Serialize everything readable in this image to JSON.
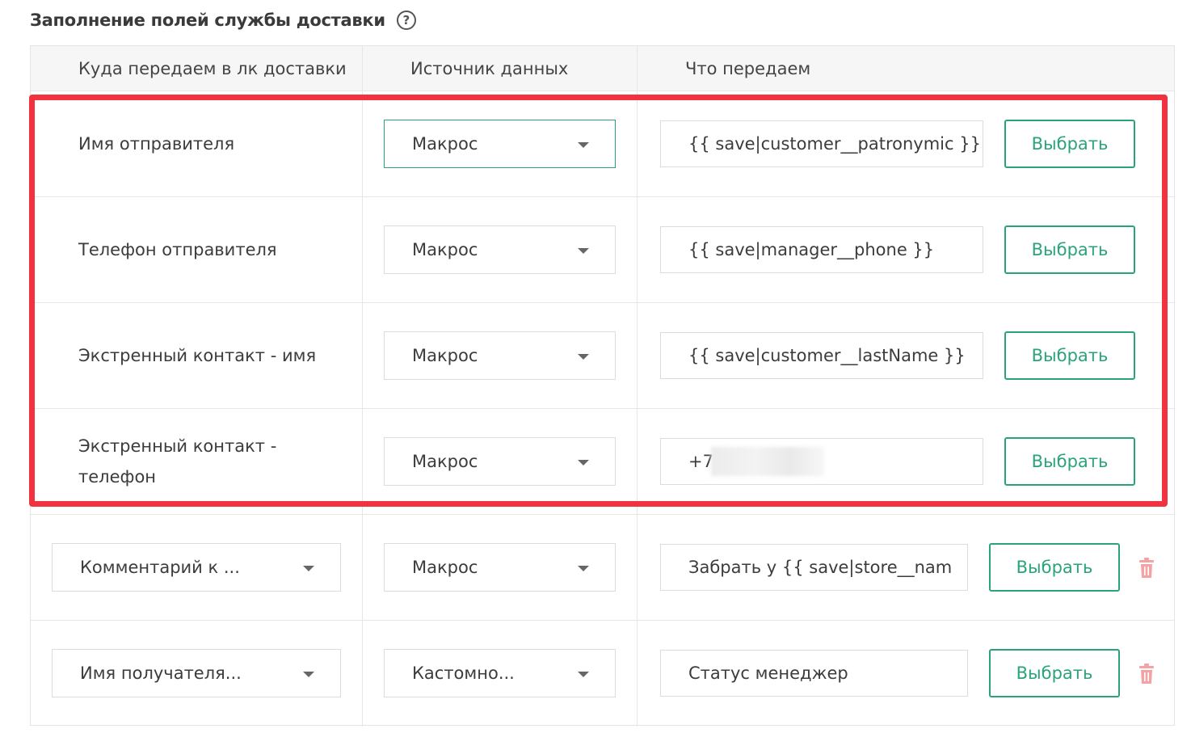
{
  "section": {
    "title": "Заполнение полей службы доставки",
    "help": "?"
  },
  "header": {
    "col1": "Куда передаем в лк доставки",
    "col2": "Источник данных",
    "col3": "Что передаем"
  },
  "rows": [
    {
      "label": "Имя отправителя",
      "source": "Макрос",
      "value": "{{ save|customer__patronymic }}",
      "button": "Выбрать"
    },
    {
      "label": "Телефон отправителя",
      "source": "Макрос",
      "value": "{{ save|manager__phone }}",
      "button": "Выбрать"
    },
    {
      "label": "Экстренный контакт - имя",
      "source": "Макрос",
      "value": "{{ save|customer__lastName }}",
      "button": "Выбрать"
    },
    {
      "label_line1": "Экстренный контакт -",
      "label_line2": "телефон",
      "source": "Макрос",
      "value": "+7",
      "button": "Выбрать"
    },
    {
      "field": "Комментарий к ...",
      "source": "Макрос",
      "value": "Забрать у {{ save|store__nam",
      "button": "Выбрать"
    },
    {
      "field": "Имя получателя...",
      "source": "Кастомно...",
      "value": "Статус менеджер",
      "button": "Выбрать"
    }
  ],
  "colors": {
    "accent": "#2aa37a",
    "highlight": "#f2323f",
    "trash": "#f3a3a3"
  }
}
